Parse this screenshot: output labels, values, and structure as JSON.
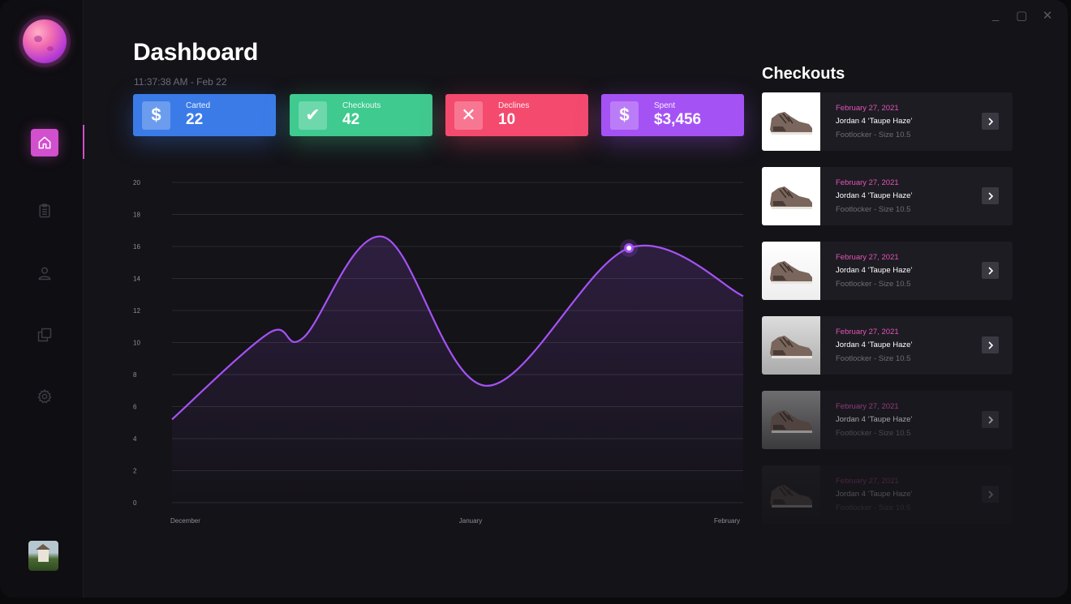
{
  "window": {
    "controls": [
      "_",
      "▢",
      "✕"
    ]
  },
  "sidebar": {
    "nav": [
      {
        "icon": "home-icon",
        "active": true
      },
      {
        "icon": "clipboard-icon",
        "active": false
      },
      {
        "icon": "user-icon",
        "active": false
      },
      {
        "icon": "copy-icon",
        "active": false
      },
      {
        "icon": "gear-icon",
        "active": false
      }
    ]
  },
  "header": {
    "title": "Dashboard",
    "timestamp": "11:37:38 AM - Feb 22"
  },
  "stats": [
    {
      "label": "Carted",
      "value": "22",
      "icon": "$",
      "color": "#3b7be8"
    },
    {
      "label": "Checkouts",
      "value": "42",
      "icon": "✔",
      "color": "#3fca90"
    },
    {
      "label": "Declines",
      "value": "10",
      "icon": "✕",
      "color": "#f44a6e"
    },
    {
      "label": "Spent",
      "value": "$3,456",
      "icon": "$",
      "color": "#a552f5"
    }
  ],
  "chart_data": {
    "type": "line",
    "y_ticks": [
      "20",
      "18",
      "16",
      "14",
      "12",
      "10",
      "8",
      "6",
      "4",
      "2",
      "0"
    ],
    "ylim": [
      0,
      20
    ],
    "x_labels": [
      "December",
      "January",
      "February"
    ],
    "series": [
      {
        "values": [
          {
            "x": 0.0,
            "y": 5.2
          },
          {
            "x": 0.17,
            "y": 10.6
          },
          {
            "x": 0.23,
            "y": 10.3
          },
          {
            "x": 0.37,
            "y": 16.6
          },
          {
            "x": 0.55,
            "y": 7.3
          },
          {
            "x": 0.8,
            "y": 15.9
          },
          {
            "x": 1.0,
            "y": 12.9
          }
        ]
      }
    ],
    "highlight_index": 5,
    "line_color": "#a552f5",
    "grid": true
  },
  "checkouts": {
    "title": "Checkouts",
    "items": [
      {
        "date": "February 27, 2021",
        "name": "Jordan 4 ‘Taupe Haze’",
        "store": "Footlocker - Size 10.5"
      },
      {
        "date": "February 27, 2021",
        "name": "Jordan 4 ‘Taupe Haze’",
        "store": "Footlocker - Size 10.5"
      },
      {
        "date": "February 27, 2021",
        "name": "Jordan 4 ‘Taupe Haze’",
        "store": "Footlocker - Size 10.5"
      },
      {
        "date": "February 27, 2021",
        "name": "Jordan 4 ‘Taupe Haze’",
        "store": "Footlocker - Size 10.5"
      },
      {
        "date": "February 27, 2021",
        "name": "Jordan 4 ‘Taupe Haze’",
        "store": "Footlocker - Size 10.5"
      },
      {
        "date": "February 27, 2021",
        "name": "Jordan 4 ‘Taupe Haze’",
        "store": "Footlocker - Size 10.5"
      }
    ]
  }
}
